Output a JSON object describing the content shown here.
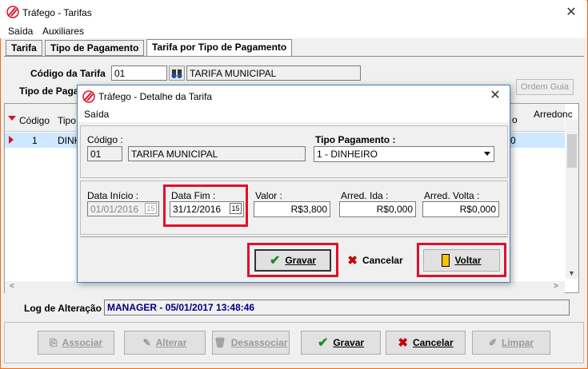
{
  "window": {
    "title": "Tráfego - Tarifas"
  },
  "menu": {
    "items": [
      "Saída",
      "Auxiliares"
    ]
  },
  "tabs": [
    "Tarifa",
    "Tipo de Pagamento",
    "Tarifa por Tipo de Pagamento"
  ],
  "form": {
    "codigo_label": "Código da Tarifa",
    "codigo_value": "01",
    "tarifa_name": "TARIFA MUNICIPAL",
    "tipo_label": "Tipo de Paga",
    "ordem_guia_label": "Ordem Guia"
  },
  "grid": {
    "headers": [
      "Código",
      "Tipo",
      "Arredonc"
    ],
    "header_partial": "o",
    "row": {
      "codigo": "1",
      "tipo": "DINH",
      "tail": "0"
    }
  },
  "log": {
    "label": "Log de Alteração",
    "value": "MANAGER - 05/01/2017 13:48:46"
  },
  "bottom_buttons": {
    "associar": "Associar",
    "alterar": "Alterar",
    "desassociar": "Desassociar",
    "gravar": "Gravar",
    "cancelar": "Cancelar",
    "limpar": "Limpar"
  },
  "dialog": {
    "title": "Tráfego - Detalhe da Tarifa",
    "menu": "Saída",
    "codigo_label": "Código :",
    "codigo_value": "01",
    "tarifa_name": "TARIFA MUNICIPAL",
    "tipo_pagamento_label": "Tipo Pagamento :",
    "tipo_pagamento_value": "1 - DINHEIRO",
    "data_inicio_label": "Data Início :",
    "data_inicio_value": "01/01/2016",
    "data_fim_label": "Data Fim :",
    "data_fim_value": "31/12/2016",
    "calendar_glyph": "15",
    "valor_label": "Valor :",
    "valor_value": "R$3,800",
    "arred_ida_label": "Arred. Ida :",
    "arred_ida_value": "R$0,000",
    "arred_volta_label": "Arred. Volta :",
    "arred_volta_value": "R$0,000",
    "gravar": "Gravar",
    "cancelar": "Cancelar",
    "voltar": "Voltar"
  },
  "colors": {
    "accent": "#e0102a",
    "log_text": "#000080",
    "selected_row": "#cde8ff"
  }
}
